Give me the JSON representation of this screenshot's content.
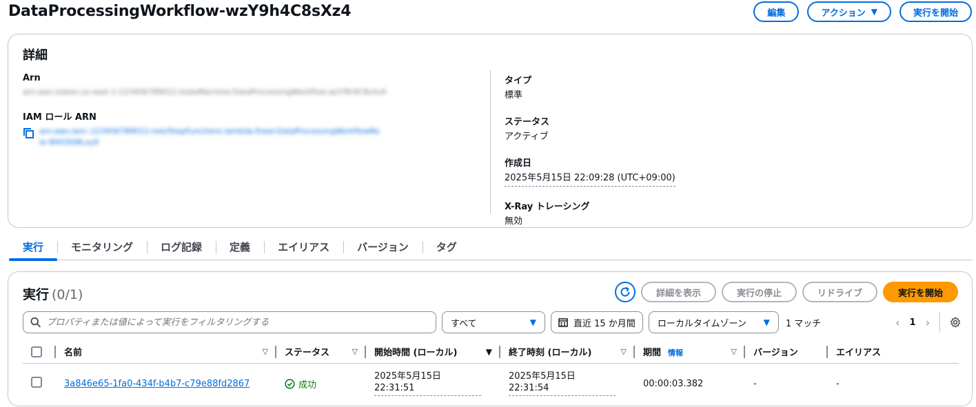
{
  "header": {
    "title": "DataProcessingWorkflow-wzY9h4C8sXz4",
    "edit_label": "編集",
    "actions_label": "アクション",
    "start_label": "実行を開始"
  },
  "details": {
    "heading": "詳細",
    "arn_label": "Arn",
    "arn_value": "arn:aws:states:us-east-1:123456789012:stateMachine:DataProcessingWorkflow-wzY9h4C8sXz4",
    "iam_label": "IAM ロール ARN",
    "iam_value_line1": "arn:aws:iam::123456789012:role/StepFunctions-lambda-fixed-DataProcessingWorkflowRo",
    "iam_value_line2": "le-9HG5D8Lxy9",
    "type_label": "タイプ",
    "type_value": "標準",
    "status_label": "ステータス",
    "status_value": "アクティブ",
    "created_label": "作成日",
    "created_value": "2025年5月15日 22:09:28 (UTC+09:00)",
    "xray_label": "X-Ray トレーシング",
    "xray_value": "無効"
  },
  "tabs": [
    "実行",
    "モニタリング",
    "ログ記録",
    "定義",
    "エイリアス",
    "バージョン",
    "タグ"
  ],
  "executions": {
    "title": "実行",
    "count": "(0/1)",
    "view_details_label": "詳細を表示",
    "stop_label": "実行の停止",
    "redrive_label": "リドライブ",
    "start_label": "実行を開始",
    "search_placeholder": "プロパティまたは値によって実行をフィルタリングする",
    "status_filter": "すべて",
    "date_range": "直近 15 か月間",
    "timezone": "ローカルタイムゾーン",
    "match_count": "1 マッチ",
    "page": "1",
    "columns": {
      "name": "名前",
      "status": "ステータス",
      "start": "開始時間 (ローカル)",
      "end": "終了時刻 (ローカル)",
      "duration": "期間",
      "duration_info": "情報",
      "version": "バージョン",
      "alias": "エイリアス"
    },
    "rows": [
      {
        "name": "3a846e65-1fa0-434f-b4b7-c79e88fd2867",
        "status": "成功",
        "start_date": "2025年5月15日",
        "start_time": "22:31:51",
        "end_date": "2025年5月15日",
        "end_time": "22:31:54",
        "duration": "00:00:03.382",
        "version": "-",
        "alias": "-"
      }
    ]
  },
  "colors": {
    "accent": "#006ce0",
    "primary_button": "#ff9900",
    "success": "#037f0c"
  }
}
